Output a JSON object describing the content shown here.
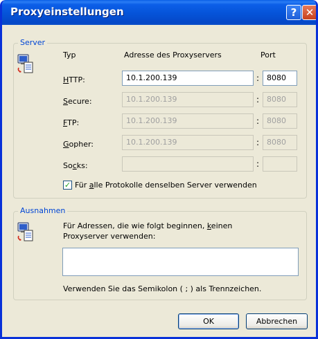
{
  "window": {
    "title": "Proxyeinstellungen",
    "help_glyph": "?",
    "close_glyph": "✕"
  },
  "server": {
    "group_label": "Server",
    "col_type": "Typ",
    "col_address": "Adresse des Proxyservers",
    "col_port": "Port",
    "rows": [
      {
        "label_ul": "H",
        "label_rest": "TTP:",
        "address": "10.1.200.139",
        "port": "8080",
        "enabled": true
      },
      {
        "label_ul": "S",
        "label_rest": "ecure:",
        "address": "10.1.200.139",
        "port": "8080",
        "enabled": false
      },
      {
        "label_ul": "F",
        "label_rest": "TP:",
        "address": "10.1.200.139",
        "port": "8080",
        "enabled": false
      },
      {
        "label_ul": "G",
        "label_rest": "opher:",
        "address": "10.1.200.139",
        "port": "8080",
        "enabled": false
      },
      {
        "label_pre": "So",
        "label_ul": "c",
        "label_rest": "ks:",
        "address": "",
        "port": "",
        "enabled": false
      }
    ],
    "colon": ":",
    "same_server_checked": true,
    "same_server_pre": "Für ",
    "same_server_ul": "a",
    "same_server_rest": "lle Protokolle denselben Server verwenden"
  },
  "exceptions": {
    "group_label": "Ausnahmen",
    "desc_line1_pre": "Für Adressen, die wie folgt beginnen, ",
    "desc_line1_ul": "k",
    "desc_line1_rest": "einen",
    "desc_line2": "Proxyserver verwenden:",
    "value": "",
    "hint": "Verwenden Sie das Semikolon ( ; ) als Trennzeichen."
  },
  "buttons": {
    "ok": "OK",
    "cancel": "Abbrechen"
  },
  "colors": {
    "titlebar": "#0553d8",
    "group_label": "#0046d5",
    "dialog_bg": "#ece9d8"
  }
}
